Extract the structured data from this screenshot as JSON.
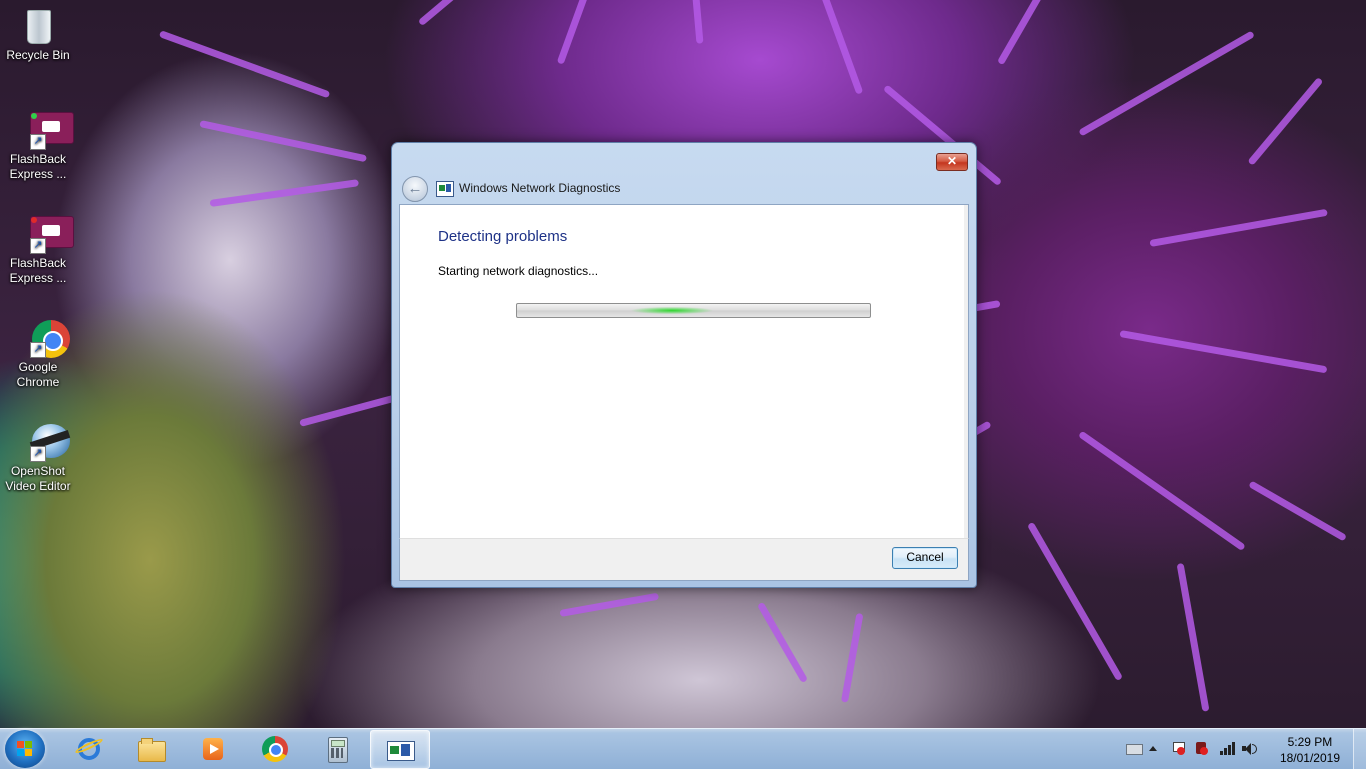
{
  "desktop": {
    "icons": [
      {
        "label": "Recycle Bin"
      },
      {
        "label": "FlashBack Express ..."
      },
      {
        "label": "FlashBack Express ..."
      },
      {
        "label": "Google Chrome"
      },
      {
        "label": "OpenShot Video Editor"
      }
    ]
  },
  "window": {
    "title": "Windows Network Diagnostics",
    "heading": "Detecting problems",
    "status": "Starting network diagnostics...",
    "cancel_label": "Cancel",
    "close_glyph": "✕",
    "back_glyph": "←"
  },
  "taskbar": {
    "items": [
      "start-orb",
      "internet-explorer",
      "windows-explorer",
      "media-player",
      "google-chrome",
      "calculator",
      "network-diagnostics"
    ],
    "active_item": "network-diagnostics",
    "clock": {
      "time": "5:29 PM",
      "date": "18/01/2019"
    }
  },
  "colors": {
    "heading": "#1e3287",
    "progress_glow": "#2dd62d",
    "window_frame": "#b9cfe9"
  }
}
